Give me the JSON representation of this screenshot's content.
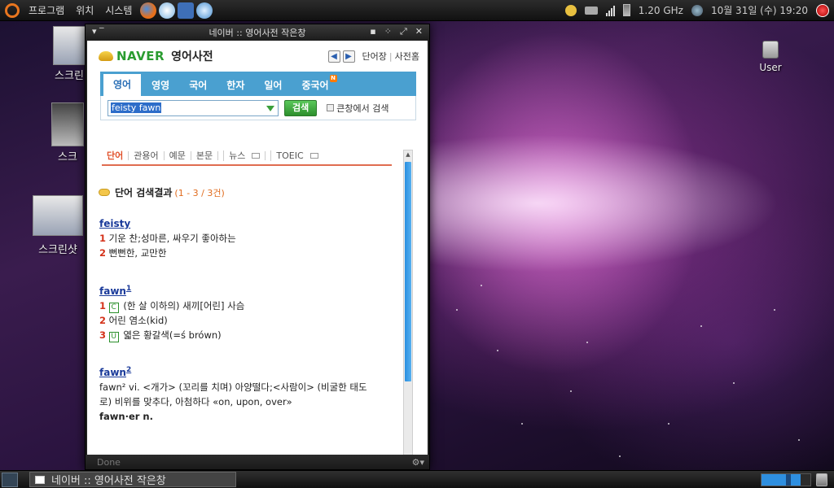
{
  "top_panel": {
    "menus": [
      "프로그램",
      "위치",
      "시스템"
    ],
    "cpu_freq": "1.20 GHz",
    "clock": "10월 31일 (수) 19:20"
  },
  "desktop_icons": [
    {
      "label": "스크린"
    },
    {
      "label": "스크"
    },
    {
      "label": "스크린샷"
    },
    {
      "label": "User"
    }
  ],
  "window": {
    "title": "네이버 :: 영어사전 작은창",
    "logo_text": "NAVER",
    "dict_title": "영어사전",
    "nav_links": {
      "wordbook": "단어장",
      "home": "사전홈"
    },
    "tabs": [
      {
        "label": "영어",
        "active": true
      },
      {
        "label": "영영"
      },
      {
        "label": "국어"
      },
      {
        "label": "한자"
      },
      {
        "label": "일어"
      },
      {
        "label": "중국어",
        "badge": "N"
      }
    ],
    "search": {
      "value": "feisty fawn",
      "button": "검색",
      "option": "큰창에서 검색"
    },
    "sub_tabs": [
      "단어",
      "관용어",
      "예문",
      "본문",
      "뉴스",
      "TOEIC"
    ],
    "result_header": {
      "label": "단어 검색결과",
      "count": "(1 - 3 / 3건)"
    },
    "entries": [
      {
        "word": "feisty",
        "sup": "",
        "lines": [
          {
            "num": "1",
            "text": "기운 찬;성마른, 싸우기 좋아하는"
          },
          {
            "num": "2",
            "text": "뻔뻔한, 교만한"
          }
        ]
      },
      {
        "word": "fawn",
        "sup": "1",
        "lines": [
          {
            "num": "1",
            "tag": "C",
            "text": "(한 살 이하의) 새끼[어린] 사슴"
          },
          {
            "num": "2",
            "text": "어린 염소(kid)"
          },
          {
            "num": "3",
            "tag": "U",
            "text": "엷은 황갈색(=ś brówn)"
          }
        ]
      },
      {
        "word": "fawn",
        "sup": "2",
        "def_line1": "fawn² vi. <개가> (꼬리를 치며) 아양떨다;<사람이> (비굴한 태도",
        "def_line2": "로) 비위를 맞추다, 아첨하다  «on, upon, over»",
        "deriv": "fawn·er n."
      }
    ],
    "status": "Done"
  },
  "bottom_panel": {
    "task_label": "네이버 :: 영어사전 작은창"
  }
}
